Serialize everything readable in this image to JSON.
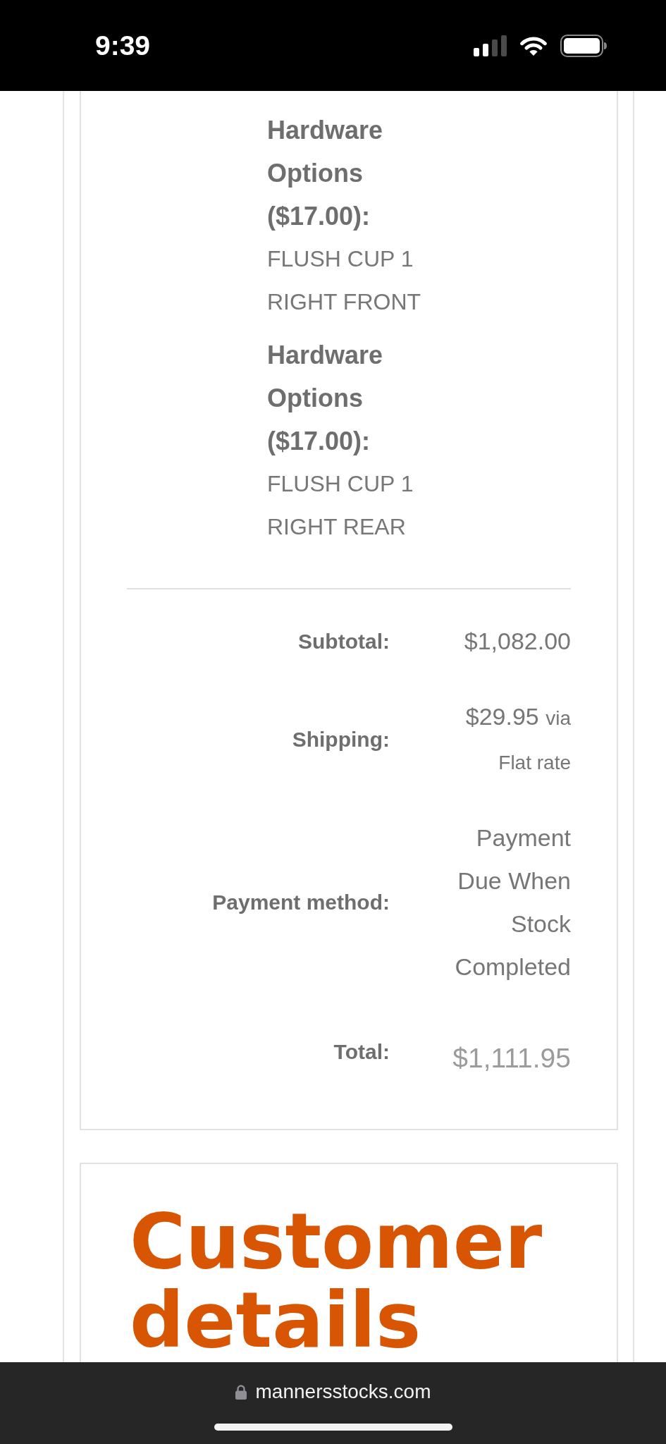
{
  "status_bar": {
    "time": "9:39"
  },
  "order_details": {
    "item_meta": [
      {
        "label": "Hardware Options ($17.00):",
        "value": "FLUSH CUP 1 RIGHT FRONT"
      },
      {
        "label": "Hardware Options ($17.00):",
        "value": "FLUSH CUP 1 RIGHT REAR"
      }
    ],
    "totals": [
      {
        "kind": "line",
        "label": "Subtotal:",
        "value": "$1,082.00"
      },
      {
        "kind": "shipping",
        "label": "Shipping:",
        "value": "$29.95",
        "method": "via Flat rate"
      },
      {
        "kind": "line",
        "label": "Payment method:",
        "value": "Payment Due When Stock Completed"
      },
      {
        "kind": "total",
        "label": "Total:",
        "value": "$1,111.95"
      }
    ]
  },
  "customer_details": {
    "heading": "Customer details"
  },
  "browser_bar": {
    "url": "mannersstocks.com"
  }
}
